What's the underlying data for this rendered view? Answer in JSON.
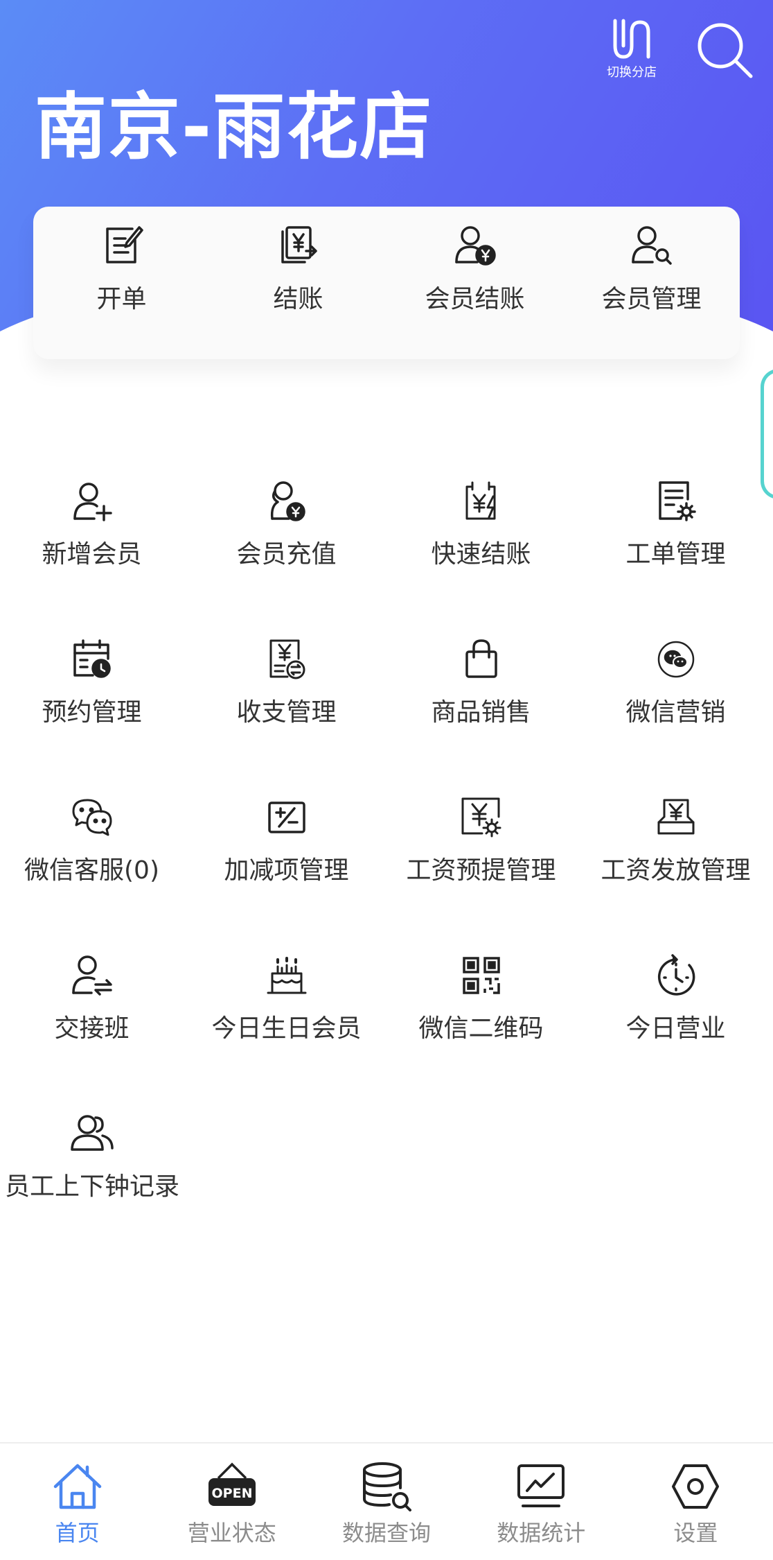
{
  "header": {
    "store_name": "南京-雨花店",
    "switch_label": "切换分店",
    "search_icon": "search-icon"
  },
  "quick_actions": [
    {
      "label": "开单",
      "icon": "edit-note-icon"
    },
    {
      "label": "结账",
      "icon": "checkout-yen-icon"
    },
    {
      "label": "会员结账",
      "icon": "member-checkout-icon"
    },
    {
      "label": "会员管理",
      "icon": "member-search-icon"
    }
  ],
  "menu": [
    {
      "label": "新增会员",
      "icon": "add-member-icon"
    },
    {
      "label": "会员充值",
      "icon": "member-recharge-icon"
    },
    {
      "label": "快速结账",
      "icon": "quick-checkout-icon"
    },
    {
      "label": "工单管理",
      "icon": "work-order-icon"
    },
    {
      "label": "预约管理",
      "icon": "appointment-calendar-icon"
    },
    {
      "label": "收支管理",
      "icon": "income-expense-icon"
    },
    {
      "label": "商品销售",
      "icon": "shopping-bag-icon"
    },
    {
      "label": "微信营销",
      "icon": "wechat-marketing-icon"
    },
    {
      "label": "微信客服(0)",
      "icon": "wechat-service-icon"
    },
    {
      "label": "加减项管理",
      "icon": "plus-minus-icon"
    },
    {
      "label": "工资预提管理",
      "icon": "salary-accrual-icon"
    },
    {
      "label": "工资发放管理",
      "icon": "salary-payout-icon"
    },
    {
      "label": "交接班",
      "icon": "shift-handover-icon"
    },
    {
      "label": "今日生日会员",
      "icon": "birthday-cake-icon"
    },
    {
      "label": "微信二维码",
      "icon": "qr-code-icon"
    },
    {
      "label": "今日营业",
      "icon": "today-business-clock-icon"
    },
    {
      "label": "员工上下钟记录",
      "icon": "staff-clock-icon"
    }
  ],
  "bottom_nav": [
    {
      "label": "首页",
      "icon": "home-icon",
      "active": true
    },
    {
      "label": "营业状态",
      "icon": "open-sign-icon",
      "active": false
    },
    {
      "label": "数据查询",
      "icon": "database-search-icon",
      "active": false
    },
    {
      "label": "数据统计",
      "icon": "chart-monitor-icon",
      "active": false
    },
    {
      "label": "设置",
      "icon": "settings-hexagon-icon",
      "active": false
    }
  ],
  "colors": {
    "accent": "#4a86f0",
    "header_start": "#5b8cf6",
    "header_end": "#5a55f2",
    "side_tab": "#56d3cf"
  }
}
